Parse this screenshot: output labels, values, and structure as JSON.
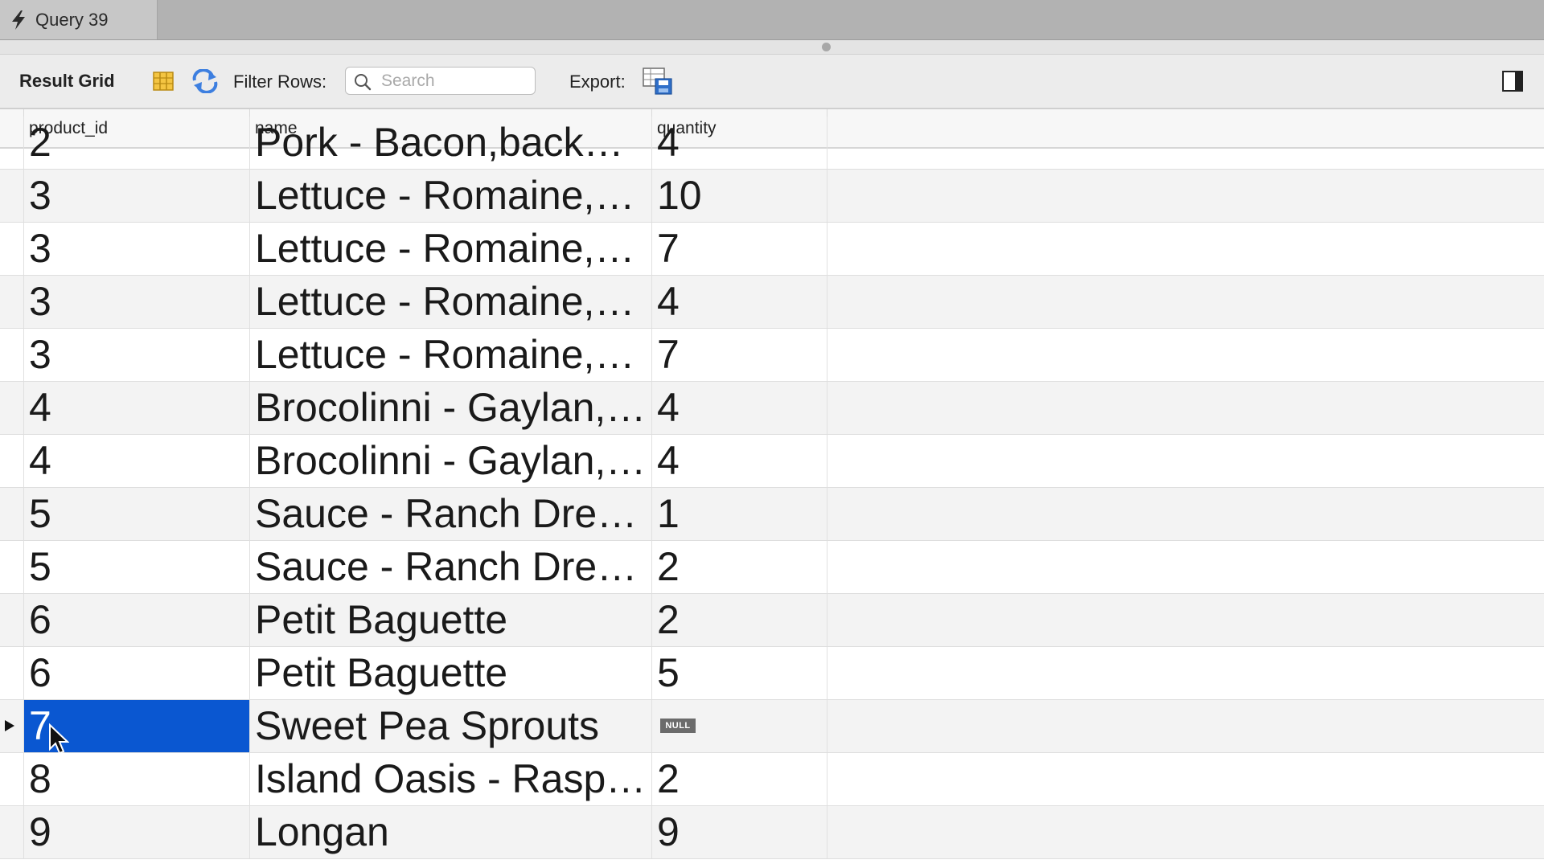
{
  "tab": {
    "label": "Query 39"
  },
  "toolbar": {
    "title": "Result Grid",
    "filter_label": "Filter Rows:",
    "search_placeholder": "Search",
    "search_value": "",
    "export_label": "Export:"
  },
  "columns": [
    {
      "label": "product_id"
    },
    {
      "label": "name"
    },
    {
      "label": "quantity"
    }
  ],
  "rows": [
    {
      "product_id": "2",
      "name": "Pork - Bacon,back…",
      "quantity": "4",
      "partial": true
    },
    {
      "product_id": "3",
      "name": "Lettuce - Romaine,…",
      "quantity": "10"
    },
    {
      "product_id": "3",
      "name": "Lettuce - Romaine,…",
      "quantity": "7"
    },
    {
      "product_id": "3",
      "name": "Lettuce - Romaine,…",
      "quantity": "4"
    },
    {
      "product_id": "3",
      "name": "Lettuce - Romaine,…",
      "quantity": "7"
    },
    {
      "product_id": "4",
      "name": "Brocolinni - Gaylan,…",
      "quantity": "4"
    },
    {
      "product_id": "4",
      "name": "Brocolinni - Gaylan,…",
      "quantity": "4"
    },
    {
      "product_id": "5",
      "name": "Sauce - Ranch Dre…",
      "quantity": "1"
    },
    {
      "product_id": "5",
      "name": "Sauce - Ranch Dre…",
      "quantity": "2"
    },
    {
      "product_id": "6",
      "name": "Petit Baguette",
      "quantity": "2"
    },
    {
      "product_id": "6",
      "name": "Petit Baguette",
      "quantity": "5"
    },
    {
      "product_id": "7",
      "name": "Sweet Pea Sprouts",
      "quantity": "NULL",
      "selected": true,
      "quantity_is_null": true
    },
    {
      "product_id": "8",
      "name": "Island Oasis - Rasp…",
      "quantity": "2"
    },
    {
      "product_id": "9",
      "name": "Longan",
      "quantity": "9"
    }
  ],
  "colors": {
    "selection": "#0a57d1",
    "null_badge": "#6b6b6b"
  },
  "icons": [
    "lightning-bolt-icon",
    "column-grid-icon",
    "refresh-icon",
    "search-icon",
    "export-icon",
    "toggle-panel-icon",
    "mouse-cursor-icon"
  ]
}
